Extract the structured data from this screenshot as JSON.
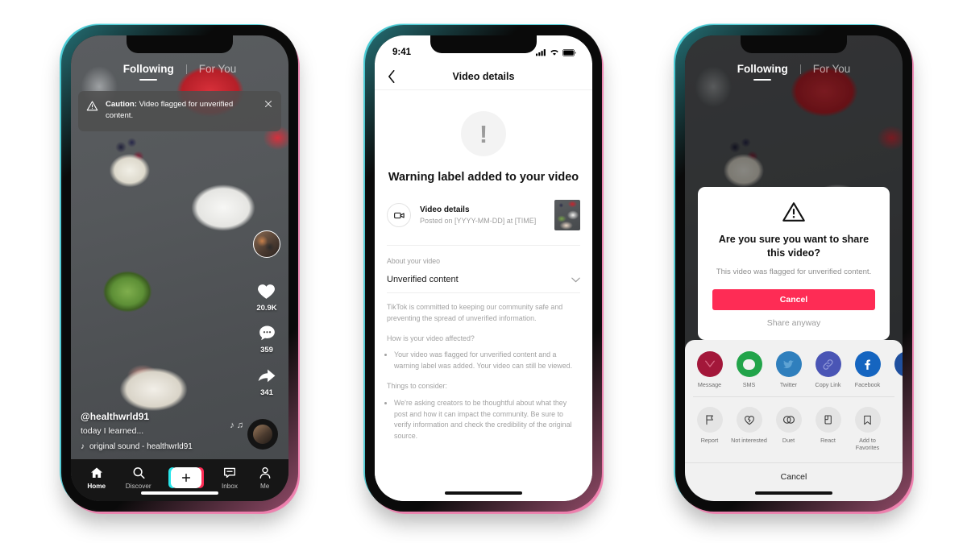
{
  "phone1": {
    "tabs": [
      {
        "label": "Following",
        "active": true
      },
      {
        "label": "For You",
        "active": false
      }
    ],
    "banner": {
      "prefix": "Caution:",
      "text": " Video flagged for unverified content.",
      "close_icon": "close-icon",
      "warning_icon": "warning-triangle-icon"
    },
    "rail": {
      "like_count": "20.9K",
      "comment_count": "359",
      "share_count": "341"
    },
    "caption": {
      "handle": "@healthwrld91",
      "description": "today I learned...",
      "music": "original sound - healthwrld91",
      "music_icon": "music-note-icon"
    },
    "nav": [
      {
        "label": "Home",
        "icon": "home-icon"
      },
      {
        "label": "Discover",
        "icon": "search-icon"
      },
      {
        "label": "",
        "icon": "plus-icon"
      },
      {
        "label": "Inbox",
        "icon": "inbox-icon"
      },
      {
        "label": "Me",
        "icon": "person-icon"
      }
    ]
  },
  "phone2": {
    "status": {
      "time": "9:41",
      "signal_icon": "cellular-icon",
      "wifi_icon": "wifi-icon",
      "battery_icon": "battery-icon"
    },
    "header": {
      "title": "Video details",
      "back_icon": "chevron-left-icon"
    },
    "hero": {
      "badge_glyph": "!",
      "title": "Warning label added to your video"
    },
    "video_row": {
      "icon": "video-camera-icon",
      "title": "Video details",
      "subtitle": "Posted on [YYYY-MM-DD] at [TIME]"
    },
    "section_label": "About your video",
    "accordion": {
      "title": "Unverified content",
      "chevron_icon": "chevron-down-icon"
    },
    "paragraph1": "TikTok is committed to keeping our community safe and preventing the spread of unverified information.",
    "question": "How is your video affected?",
    "bullets1": [
      "Your video was flagged for unverified content and a warning label was added. Your video can still be viewed."
    ],
    "question2": "Things to consider:",
    "bullets2": [
      "We're asking creators to be thoughtful about what they post and how it can impact the community. Be sure to verify information and check the credibility of the original source."
    ]
  },
  "phone3": {
    "tabs": [
      {
        "label": "Following",
        "active": true
      },
      {
        "label": "For You",
        "active": false
      }
    ],
    "share_targets": [
      {
        "label": "Message",
        "icon": "message-icon",
        "color": "#a3173a"
      },
      {
        "label": "SMS",
        "icon": "sms-icon",
        "color": "#22a44a"
      },
      {
        "label": "Twitter",
        "icon": "twitter-icon",
        "color": "#2f7fbd"
      },
      {
        "label": "Copy Link",
        "icon": "link-icon",
        "color": "#4a55b5"
      },
      {
        "label": "Facebook",
        "icon": "facebook-icon",
        "color": "#1565c0"
      },
      {
        "label": "",
        "icon": "more-share-icon",
        "color": "#1f4f9e"
      }
    ],
    "actions": [
      {
        "label": "Report",
        "icon": "flag-icon"
      },
      {
        "label": "Not interested",
        "icon": "broken-heart-icon"
      },
      {
        "label": "Duet",
        "icon": "duet-icon"
      },
      {
        "label": "React",
        "icon": "react-icon"
      },
      {
        "label": "Add to Favorites",
        "icon": "bookmark-icon"
      }
    ],
    "sheet_cancel": "Cancel",
    "modal": {
      "warning_icon": "warning-triangle-icon",
      "title": "Are you sure you want to share this video?",
      "body": "This video was flagged for unverified content.",
      "primary_button": "Cancel",
      "secondary_button": "Share anyway",
      "primary_color": "#fe2c55"
    }
  }
}
